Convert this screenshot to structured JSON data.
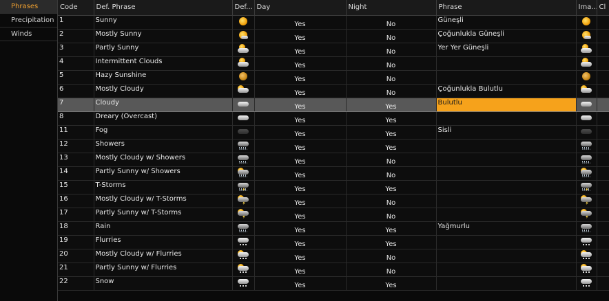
{
  "sidebar": {
    "tabs": [
      {
        "label": "Phrases",
        "active": true
      },
      {
        "label": "Precipitation",
        "active": false
      },
      {
        "label": "Winds",
        "active": false
      }
    ]
  },
  "columns": [
    "Code",
    "Def. Phrase",
    "Def...",
    "Day",
    "Night",
    "Phrase",
    "Ima...",
    "Cl"
  ],
  "rows": [
    {
      "code": "1",
      "def": "Sunny",
      "icon": "sunny",
      "day": "Yes",
      "night": "No",
      "phrase": "Güneşli"
    },
    {
      "code": "2",
      "def": "Mostly Sunny",
      "icon": "mostly-sunny",
      "day": "Yes",
      "night": "No",
      "phrase": "Çoğunlukla Güneşli"
    },
    {
      "code": "3",
      "def": "Partly Sunny",
      "icon": "partly-sunny",
      "day": "Yes",
      "night": "No",
      "phrase": "Yer Yer Güneşli"
    },
    {
      "code": "4",
      "def": "Intermittent Clouds",
      "icon": "partly-sunny",
      "day": "Yes",
      "night": "No",
      "phrase": ""
    },
    {
      "code": "5",
      "def": "Hazy Sunshine",
      "icon": "hazy-sun",
      "day": "Yes",
      "night": "No",
      "phrase": ""
    },
    {
      "code": "6",
      "def": "Mostly Cloudy",
      "icon": "mostly-cloudy",
      "day": "Yes",
      "night": "No",
      "phrase": "Çoğunlukla Bulutlu"
    },
    {
      "code": "7",
      "def": "Cloudy",
      "icon": "cloudy",
      "day": "Yes",
      "night": "Yes",
      "phrase": "Bulutlu",
      "selected": true
    },
    {
      "code": "8",
      "def": "Dreary (Overcast)",
      "icon": "cloudy",
      "day": "Yes",
      "night": "Yes",
      "phrase": ""
    },
    {
      "code": "11",
      "def": "Fog",
      "icon": "fog",
      "day": "Yes",
      "night": "Yes",
      "phrase": "Sisli"
    },
    {
      "code": "12",
      "def": "Showers",
      "icon": "showers",
      "day": "Yes",
      "night": "Yes",
      "phrase": ""
    },
    {
      "code": "13",
      "def": "Mostly Cloudy w/ Showers",
      "icon": "showers",
      "day": "Yes",
      "night": "No",
      "phrase": ""
    },
    {
      "code": "14",
      "def": "Partly Sunny w/ Showers",
      "icon": "sun-showers",
      "day": "Yes",
      "night": "No",
      "phrase": ""
    },
    {
      "code": "15",
      "def": "T-Storms",
      "icon": "storm",
      "day": "Yes",
      "night": "Yes",
      "phrase": ""
    },
    {
      "code": "16",
      "def": "Mostly Cloudy w/ T-Storms",
      "icon": "sun-storm",
      "day": "Yes",
      "night": "No",
      "phrase": ""
    },
    {
      "code": "17",
      "def": "Partly Sunny w/ T-Storms",
      "icon": "sun-storm",
      "day": "Yes",
      "night": "No",
      "phrase": ""
    },
    {
      "code": "18",
      "def": "Rain",
      "icon": "rain",
      "day": "Yes",
      "night": "Yes",
      "phrase": "Yağmurlu"
    },
    {
      "code": "19",
      "def": "Flurries",
      "icon": "flurries",
      "day": "Yes",
      "night": "Yes",
      "phrase": ""
    },
    {
      "code": "20",
      "def": "Mostly Cloudy w/ Flurries",
      "icon": "sun-flurries",
      "day": "Yes",
      "night": "No",
      "phrase": ""
    },
    {
      "code": "21",
      "def": "Partly Sunny w/ Flurries",
      "icon": "sun-flurries",
      "day": "Yes",
      "night": "No",
      "phrase": ""
    },
    {
      "code": "22",
      "def": "Snow",
      "icon": "snow",
      "day": "Yes",
      "night": "Yes",
      "phrase": ""
    }
  ],
  "colors": {
    "accent": "#f6a21b",
    "selected_row": "#585858",
    "background": "#0d0d0d"
  }
}
